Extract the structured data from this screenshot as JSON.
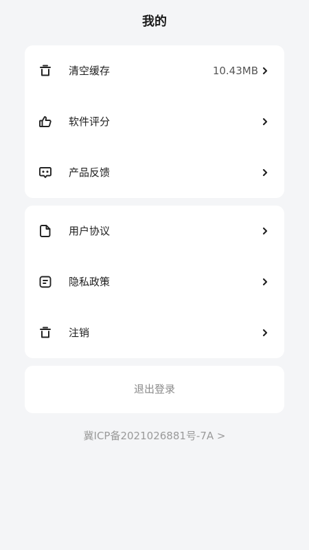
{
  "page": {
    "title": "我的"
  },
  "settings_group_1": [
    {
      "label": "清空缓存",
      "value": "10.43MB",
      "icon": "trash-icon"
    },
    {
      "label": "软件评分",
      "value": "",
      "icon": "thumbs-up-icon"
    },
    {
      "label": "产品反馈",
      "value": "",
      "icon": "chat-feedback-icon"
    }
  ],
  "settings_group_2": [
    {
      "label": "用户协议",
      "value": "",
      "icon": "document-icon"
    },
    {
      "label": "隐私政策",
      "value": "",
      "icon": "note-icon"
    },
    {
      "label": "注销",
      "value": "",
      "icon": "trash-icon"
    }
  ],
  "logout_label": "退出登录",
  "icp_text": "冀ICP备2021026881号-7A >",
  "colors": {
    "background": "#f4f5f7",
    "card": "#ffffff",
    "primary_text": "#1f1f1f",
    "muted_text": "#9a9a9a"
  }
}
